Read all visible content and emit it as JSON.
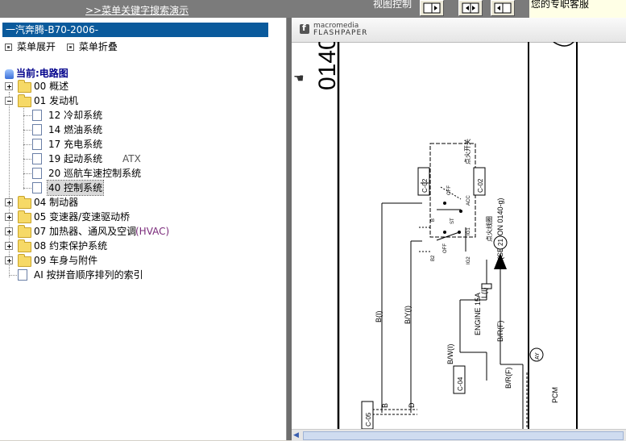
{
  "topbar": {
    "search_link": ">>菜单关键字搜索演示",
    "view_control_label": "视图控制",
    "buttons": [
      {
        "name": "layout-left-button",
        "icon": "split-left-icon"
      },
      {
        "name": "layout-both-button",
        "icon": "split-both-icon"
      },
      {
        "name": "layout-right-button",
        "icon": "split-right-icon"
      }
    ],
    "service_text": "您的专职客服"
  },
  "sidebar": {
    "doc_title": "一汽奔腾-B70-2006-",
    "expand_label": "菜单展开",
    "collapse_label": "菜单折叠",
    "current_label": "当前:电路图",
    "tree": [
      {
        "label": "00 概述",
        "expanded": false
      },
      {
        "label": "01 发动机",
        "expanded": true,
        "children": [
          {
            "label": "12 冷却系统"
          },
          {
            "label": "14 燃油系统"
          },
          {
            "label": "17 充电系统"
          },
          {
            "label": "19 起动系统",
            "suffix": "ATX"
          },
          {
            "label": "20 巡航车速控制系统"
          },
          {
            "label": "40 控制系统",
            "selected": true
          }
        ]
      },
      {
        "label": "04 制动器",
        "expanded": false
      },
      {
        "label": "05 变速器/变速驱动桥",
        "expanded": false
      },
      {
        "label": "07 加热器、通风及空调",
        "suffix": "(HVAC)",
        "expanded": false
      },
      {
        "label": "08 约束保护系统",
        "expanded": false
      },
      {
        "label": "09 车身与附件",
        "expanded": false
      },
      {
        "label": "AI 按拼音顺序排列的索引",
        "leaf": true
      }
    ]
  },
  "viewer": {
    "brand_small": "macromedia",
    "brand_big": "FLASHPAPER",
    "page_number": "0140",
    "diagram": {
      "switch_title": "点火开关",
      "ignition_coil_label": "点火线圈",
      "section_label": "(SECTION 0140-g)",
      "connectors": [
        "C-02",
        "C-02",
        "C-04",
        "C-05"
      ],
      "switch_labels": [
        "OFF",
        "ACC",
        "IG1",
        "ST",
        "IG2",
        "OFF",
        "B",
        "B2"
      ],
      "circle_labels": [
        "21",
        "AY"
      ],
      "wire_labels": [
        "B(I)",
        "B/Y(I)",
        "B/W(I)",
        "K",
        "L(I)",
        "ENGINE 15A",
        "B/R(F)",
        "B/R(F)",
        "B",
        "D"
      ],
      "module_label": "PCM"
    }
  }
}
